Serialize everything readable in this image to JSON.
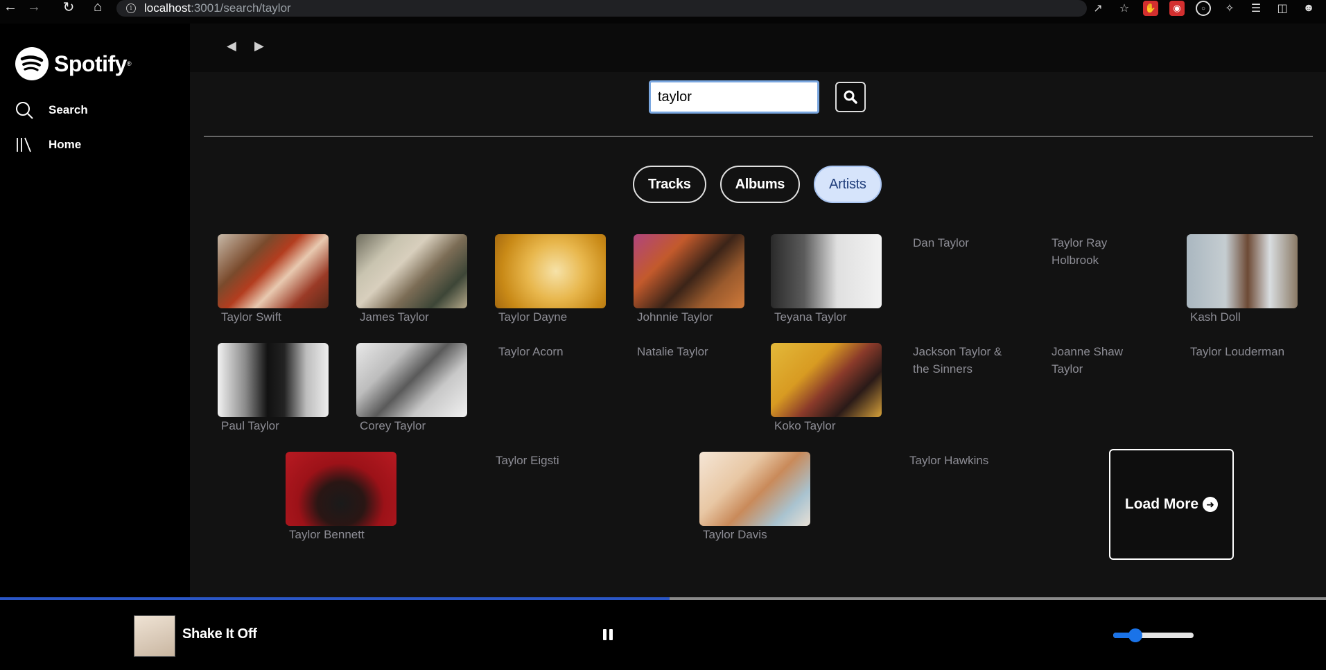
{
  "browser": {
    "url_host": "localhost",
    "url_path": ":3001/search/taylor"
  },
  "sidebar": {
    "brand": "Spotify",
    "items": [
      {
        "label": "Search",
        "icon": "search-icon"
      },
      {
        "label": "Home",
        "icon": "library-icon"
      }
    ]
  },
  "search": {
    "value": "taylor"
  },
  "tabs": [
    {
      "label": "Tracks",
      "active": false
    },
    {
      "label": "Albums",
      "active": false
    },
    {
      "label": "Artists",
      "active": true
    }
  ],
  "artists": [
    {
      "name": "Taylor Swift",
      "has_image": true
    },
    {
      "name": "James Taylor",
      "has_image": true
    },
    {
      "name": "Taylor Dayne",
      "has_image": true
    },
    {
      "name": "Johnnie Taylor",
      "has_image": true
    },
    {
      "name": "Teyana Taylor",
      "has_image": true
    },
    {
      "name": "Dan Taylor",
      "has_image": false
    },
    {
      "name": "Taylor Ray Holbrook",
      "has_image": false
    },
    {
      "name": "Kash Doll",
      "has_image": true
    },
    {
      "name": "Paul Taylor",
      "has_image": true
    },
    {
      "name": "Corey Taylor",
      "has_image": true
    },
    {
      "name": "Taylor Acorn",
      "has_image": false
    },
    {
      "name": "Natalie Taylor",
      "has_image": false
    },
    {
      "name": "Koko Taylor",
      "has_image": true
    },
    {
      "name": "Jackson Taylor & the Sinners",
      "has_image": false
    },
    {
      "name": "Joanne Shaw Taylor",
      "has_image": false
    },
    {
      "name": "Taylor Louderman",
      "has_image": false
    },
    {
      "name": "Taylor Bennett",
      "has_image": true
    },
    {
      "name": "Taylor Eigsti",
      "has_image": false
    },
    {
      "name": "Taylor Davis",
      "has_image": true
    },
    {
      "name": "Taylor Hawkins",
      "has_image": false
    }
  ],
  "load_more": {
    "label": "Load More"
  },
  "player": {
    "track_title": "Shake It Off",
    "progress": 0.505,
    "volume": 0.28
  },
  "colors": {
    "accent": "#2a56c6",
    "active_tab_bg": "#d6e4fb",
    "background": "#121212"
  }
}
